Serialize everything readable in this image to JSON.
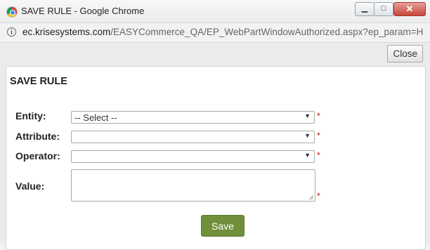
{
  "window": {
    "title": "SAVE RULE - Google Chrome",
    "controls": {
      "minimize": "▁",
      "maximize": "□",
      "close": "✕"
    }
  },
  "address_bar": {
    "domain": "ec.krisesystems.com",
    "path": "/EASYCommerce_QA/EP_WebPartWindowAuthorized.aspx?ep_param=H",
    "icon": "info-icon"
  },
  "toolbar": {
    "close_label": "Close"
  },
  "panel": {
    "title": "SAVE RULE",
    "required_marker": "*",
    "fields": {
      "entity": {
        "label": "Entity:",
        "value": "-- Select --"
      },
      "attribute": {
        "label": "Attribute:",
        "value": ""
      },
      "operator": {
        "label": "Operator:",
        "value": ""
      },
      "value": {
        "label": "Value:",
        "value": ""
      }
    },
    "save_label": "Save"
  },
  "colors": {
    "save_button": "#6f8f3a",
    "required_marker": "#dd0000"
  }
}
